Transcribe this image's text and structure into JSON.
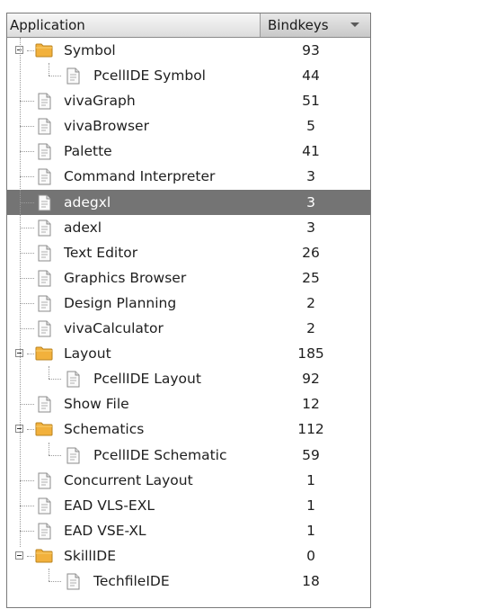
{
  "header": {
    "application_label": "Application",
    "bindkeys_label": "Bindkeys"
  },
  "rows": [
    {
      "label": "Symbol",
      "count": "93",
      "type": "folder",
      "level": 0,
      "icon": "folder-icon",
      "expanded": true
    },
    {
      "label": "PcellIDE Symbol",
      "count": "44",
      "type": "file",
      "level": 1,
      "icon": "document-icon"
    },
    {
      "label": "vivaGraph",
      "count": "51",
      "type": "file",
      "level": 0,
      "icon": "document-icon"
    },
    {
      "label": "vivaBrowser",
      "count": "5",
      "type": "file",
      "level": 0,
      "icon": "document-icon"
    },
    {
      "label": "Palette",
      "count": "41",
      "type": "file",
      "level": 0,
      "icon": "document-icon"
    },
    {
      "label": "Command Interpreter",
      "count": "3",
      "type": "file",
      "level": 0,
      "icon": "document-icon"
    },
    {
      "label": "adegxl",
      "count": "3",
      "type": "file",
      "level": 0,
      "icon": "document-icon",
      "selected": true
    },
    {
      "label": "adexl",
      "count": "3",
      "type": "file",
      "level": 0,
      "icon": "document-icon"
    },
    {
      "label": "Text Editor",
      "count": "26",
      "type": "file",
      "level": 0,
      "icon": "document-icon"
    },
    {
      "label": "Graphics Browser",
      "count": "25",
      "type": "file",
      "level": 0,
      "icon": "document-icon"
    },
    {
      "label": "Design Planning",
      "count": "2",
      "type": "file",
      "level": 0,
      "icon": "document-icon"
    },
    {
      "label": "vivaCalculator",
      "count": "2",
      "type": "file",
      "level": 0,
      "icon": "document-icon"
    },
    {
      "label": "Layout",
      "count": "185",
      "type": "folder",
      "level": 0,
      "icon": "folder-icon",
      "expanded": true
    },
    {
      "label": "PcellIDE Layout",
      "count": "92",
      "type": "file",
      "level": 1,
      "icon": "document-icon"
    },
    {
      "label": "Show File",
      "count": "12",
      "type": "file",
      "level": 0,
      "icon": "document-icon"
    },
    {
      "label": "Schematics",
      "count": "112",
      "type": "folder",
      "level": 0,
      "icon": "folder-icon",
      "expanded": true
    },
    {
      "label": "PcellIDE Schematic",
      "count": "59",
      "type": "file",
      "level": 1,
      "icon": "document-icon"
    },
    {
      "label": "Concurrent Layout",
      "count": "1",
      "type": "file",
      "level": 0,
      "icon": "document-icon"
    },
    {
      "label": "EAD VLS-EXL",
      "count": "1",
      "type": "file",
      "level": 0,
      "icon": "document-icon"
    },
    {
      "label": "EAD VSE-XL",
      "count": "1",
      "type": "file",
      "level": 0,
      "icon": "document-icon"
    },
    {
      "label": "SkillIDE",
      "count": "0",
      "type": "folder",
      "level": 0,
      "icon": "folder-icon",
      "expanded": true
    },
    {
      "label": "TechfileIDE",
      "count": "18",
      "type": "file",
      "level": 1,
      "icon": "document-icon"
    }
  ],
  "colors": {
    "selection": "#747474",
    "folder": "#f2b13c"
  }
}
